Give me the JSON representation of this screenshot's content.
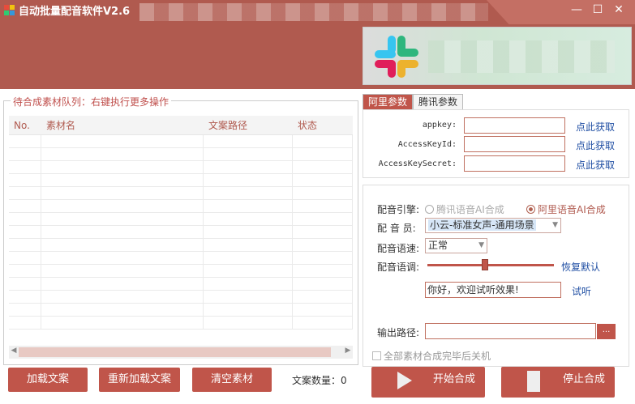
{
  "window": {
    "title": "自动批量配音软件V2.6",
    "minimize": "—",
    "maximize": "☐",
    "close": "✕"
  },
  "queue": {
    "legend": "待合成素材队列：右键执行更多操作",
    "columns": [
      "No.",
      "素材名",
      "文案路径",
      "状态"
    ],
    "rows": []
  },
  "buttons": {
    "load": "加载文案",
    "reload": "重新加载文案",
    "clear": "清空素材",
    "count_label": "文案数量：0",
    "start": "开始合成",
    "stop": "停止合成"
  },
  "tabs": [
    "阿里参数",
    "腾讯参数"
  ],
  "ali": {
    "appkey_label": "appkey:",
    "accesskeyid_label": "AccessKeyId:",
    "accesskeysecret_label": "AccessKeySecret:",
    "appkey_value": "",
    "accesskeyid_value": "",
    "accesskeysecret_value": "",
    "get_link": "点此获取"
  },
  "voice": {
    "engine_label": "配音引擎:",
    "engine_options": [
      "腾讯语音AI合成",
      "阿里语音AI合成"
    ],
    "engine_selected": "阿里语音AI合成",
    "speaker_label": "配 音 员:",
    "speaker_value": "小云-标准女声-通用场景",
    "speed_label": "配音语速:",
    "speed_value": "正常",
    "pitch_label": "配音语调:",
    "pitch_level": 0.45,
    "reset_link": "恢复默认",
    "preview_text": "你好，欢迎试听效果!",
    "preview_link": "试听",
    "output_label": "输出路径:",
    "output_value": "",
    "browse": "...",
    "shutdown_label": "全部素材合成完毕后关机"
  },
  "colors": {
    "brand": "#b05a4f",
    "button": "#c0554a",
    "link": "#1f4ea3"
  }
}
